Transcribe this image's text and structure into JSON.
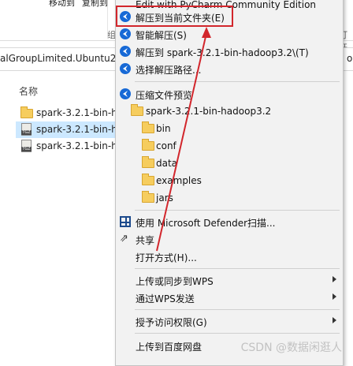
{
  "ribbon": {
    "items": [
      "移动到",
      "复制到"
    ],
    "group_label": "组",
    "right_label": "打开"
  },
  "address": {
    "path_text": "alGroupLimited.Ubuntu22.0",
    "right_text": "o"
  },
  "file_list": {
    "column_header": "名称",
    "rows": [
      {
        "name": "spark-3.2.1-bin-h",
        "type": "folder",
        "selected": false
      },
      {
        "name": "spark-3.2.1-bin-h",
        "type": "tgz",
        "selected": true
      },
      {
        "name": "spark-3.2.1-bin-h",
        "type": "tgz",
        "selected": false
      }
    ]
  },
  "context_menu": {
    "top_item": "Edit with PyCharm Community Edition",
    "bandizip_items": [
      "解压到当前文件夹(E)",
      "智能解压(S)",
      "解压到 spark-3.2.1-bin-hadoop3.2\\(T)",
      "选择解压路径..."
    ],
    "preview_label": "压缩文件预览",
    "archive_root": "spark-3.2.1-bin-hadoop3.2",
    "archive_children": [
      "bin",
      "conf",
      "data",
      "examples",
      "jars"
    ],
    "defender_label": "使用 Microsoft Defender扫描...",
    "share_label": "共享",
    "open_with_label": "打开方式(H)...",
    "wps_upload_label": "上传或同步到WPS",
    "wps_send_label": "通过WPS发送",
    "grant_access_label": "授予访问权限(G)",
    "baidu_upload_label": "上传到百度网盘"
  },
  "annotation": {
    "highlight_color": "#d2262c",
    "highlighted_item": "解压到当前文件夹(E)"
  },
  "watermark": "CSDN @数据闲逛人"
}
